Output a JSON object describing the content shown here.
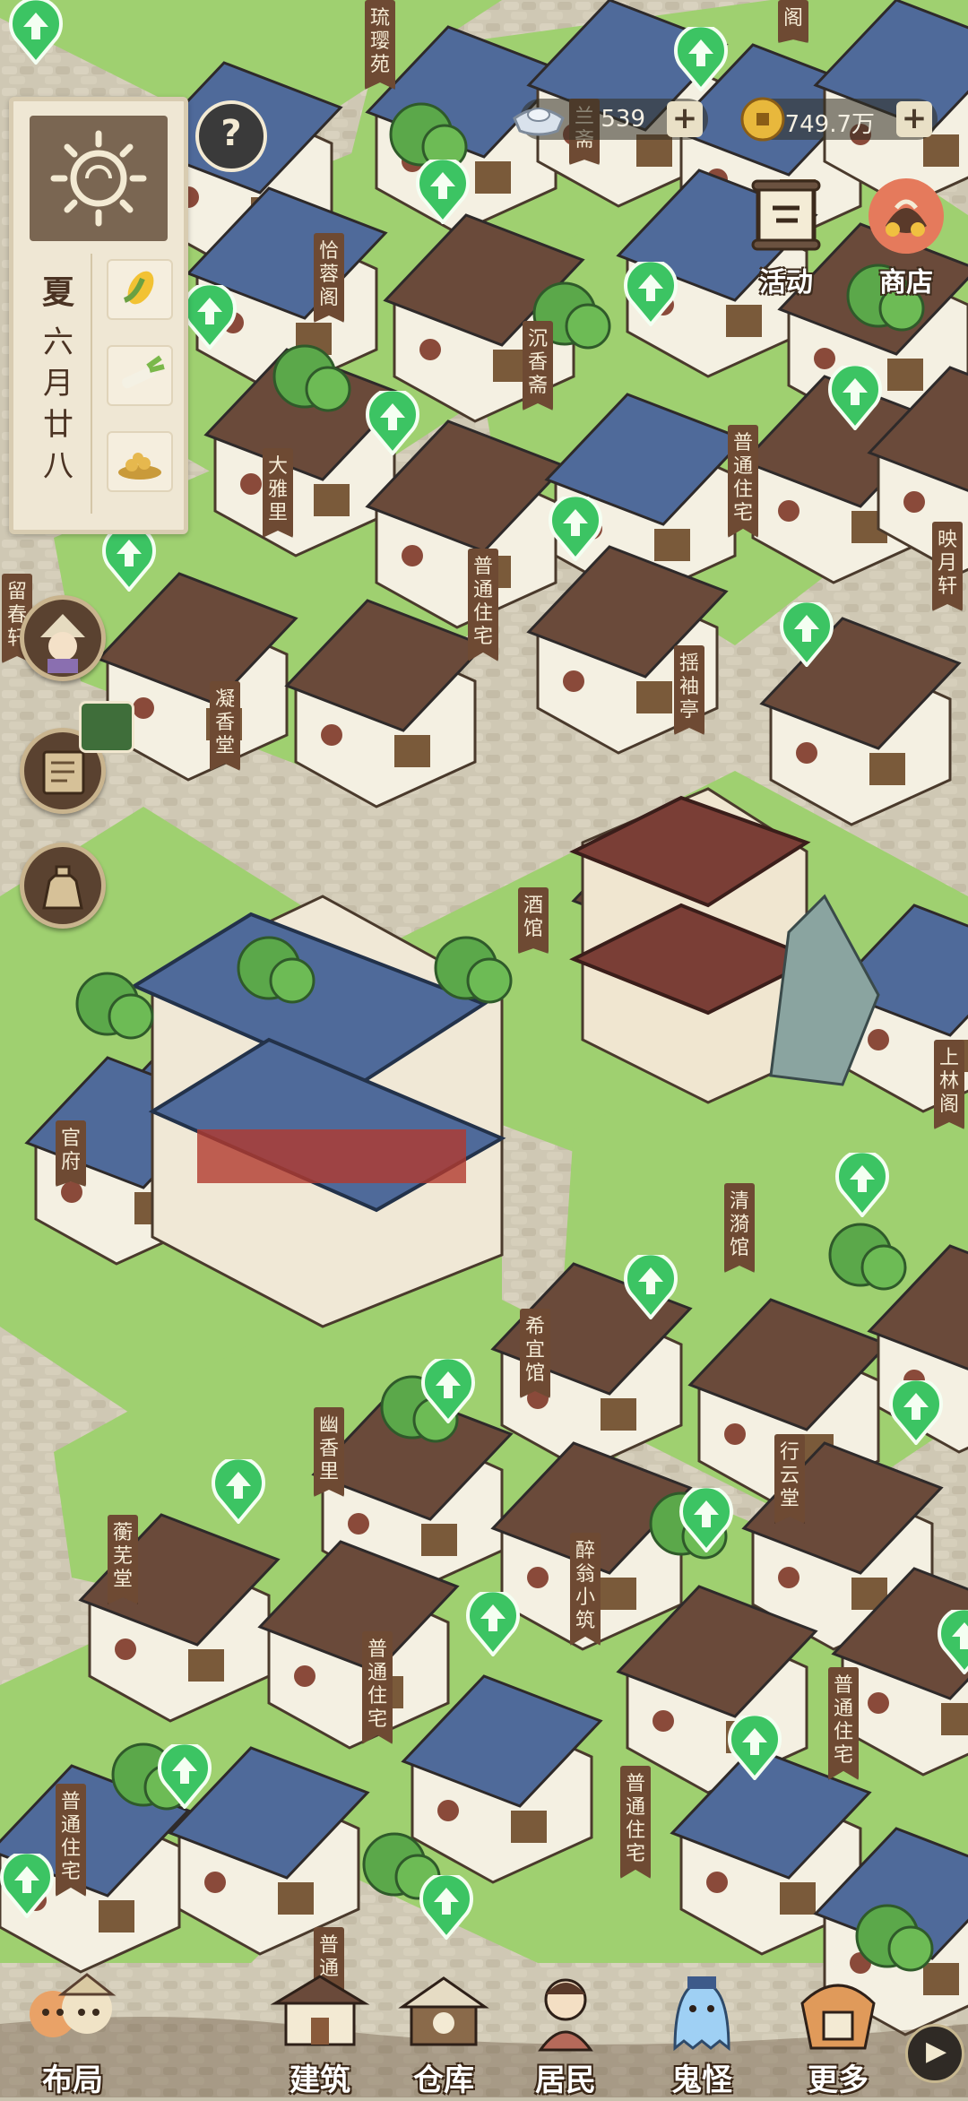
{
  "hud": {
    "season": "夏",
    "date_lines": [
      "六",
      "月",
      "廿",
      "八"
    ],
    "help_symbol": "?",
    "silver": {
      "value": "539",
      "icon": "silver-ingot-icon"
    },
    "coins": {
      "value": "749.7万",
      "icon": "copper-coin-icon"
    },
    "plus_symbol": "+",
    "activity_label": "活动",
    "shop_label": "商店",
    "crops": [
      "corn-icon",
      "scallion-icon",
      "soybean-icon"
    ]
  },
  "signs": [
    {
      "text": "琉璎苑"
    },
    {
      "text": "兰斋"
    },
    {
      "text": "恰蓉阁"
    },
    {
      "text": "沉香斋"
    },
    {
      "text": "大雅里"
    },
    {
      "text": "普通住宅"
    },
    {
      "text": "映月轩"
    },
    {
      "text": "普通住宅"
    },
    {
      "text": "揺袖亭"
    },
    {
      "text": "留春轩"
    },
    {
      "text": "凝香堂"
    },
    {
      "text": "酒馆"
    },
    {
      "text": "上林阁"
    },
    {
      "text": "官府"
    },
    {
      "text": "清漪馆"
    },
    {
      "text": "希宜馆"
    },
    {
      "text": "幽香里"
    },
    {
      "text": "行云堂"
    },
    {
      "text": "蘅芜堂"
    },
    {
      "text": "醉翁小筑"
    },
    {
      "text": "普通住宅"
    },
    {
      "text": "普通住宅"
    },
    {
      "text": "普通住宅"
    },
    {
      "text": "普通住宅"
    },
    {
      "text": "普通"
    },
    {
      "text": "阁"
    }
  ],
  "nav": [
    {
      "label": "布局",
      "icon": "layout-icon"
    },
    {
      "label": "建筑",
      "icon": "building-icon"
    },
    {
      "label": "仓库",
      "icon": "warehouse-icon"
    },
    {
      "label": "居民",
      "icon": "resident-icon"
    },
    {
      "label": "鬼怪",
      "icon": "ghost-icon"
    },
    {
      "label": "更多",
      "icon": "more-icon"
    }
  ],
  "expand_symbol": "▶",
  "colors": {
    "grass": "#9bcf6a",
    "road": "#c9c2ae",
    "roof_blue": "#4f6a9a",
    "roof_brown": "#6a4a3a",
    "sign": "#6e4a33",
    "upgrade_marker": "#3cc463"
  }
}
